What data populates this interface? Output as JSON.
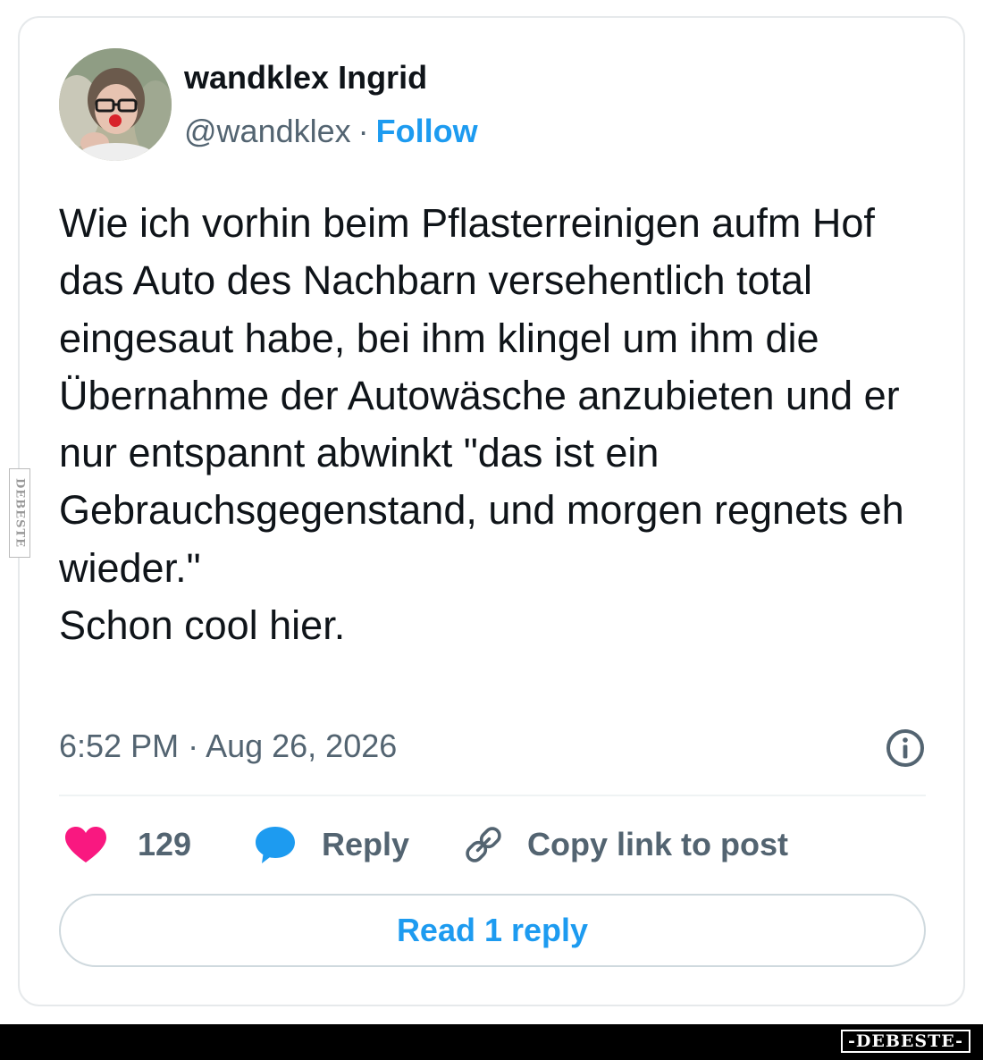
{
  "user": {
    "display_name": "wandklex Ingrid",
    "handle": "@wandklex",
    "separator": "·",
    "follow_label": "Follow"
  },
  "tweet": {
    "text": "Wie ich vorhin beim Pflasterreinigen aufm Hof das Auto des Nachbarn versehentlich total eingesaut habe, bei ihm klingel um ihm die Übernahme der Autowäsche anzubieten und er nur entspannt abwinkt \"das ist ein Gebrauchsgegenstand, und morgen regnets eh wieder.\"\nSchon cool hier.",
    "timestamp": "6:52 PM · Aug 26, 2026"
  },
  "actions": {
    "like_count": "129",
    "reply_label": "Reply",
    "copy_label": "Copy link to post"
  },
  "read_reply_label": "Read 1 reply",
  "watermark": {
    "side": "DEBESTE",
    "badge": "-DEBESTE-"
  },
  "colors": {
    "heart": "#f91880",
    "bubble": "#1d9bf0",
    "link_blue": "#1d9bf0",
    "secondary_text": "#536471",
    "primary_text": "#0f1419"
  },
  "icons": {
    "like": "heart-icon",
    "reply": "speech-bubble-icon",
    "copy": "link-icon",
    "info": "info-icon"
  }
}
